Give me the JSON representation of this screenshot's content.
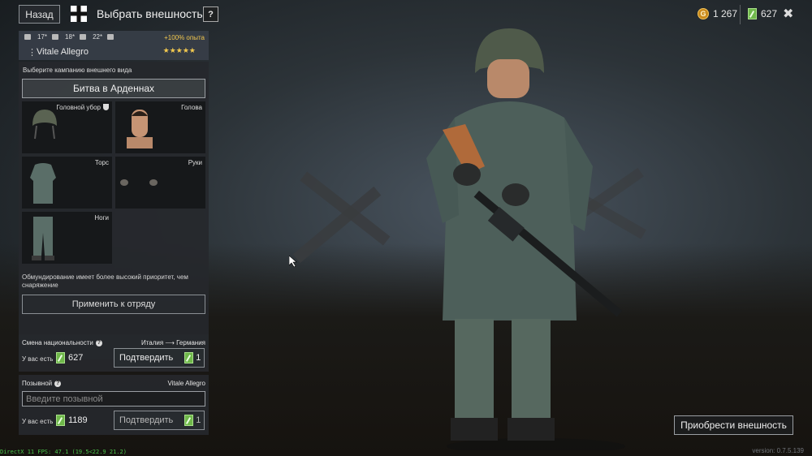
{
  "header": {
    "back_label": "Назад",
    "title": "Выбрать внешность",
    "help_label": "?",
    "gold": "1 267",
    "tickets": "627",
    "close_label": "✖"
  },
  "soldier": {
    "stat1": "17",
    "stat2": "18",
    "stat3": "22",
    "xp_bonus": "+100% опыта",
    "name": "Vitale Allegro",
    "stars": "★★★★★"
  },
  "appearance": {
    "campaign_label": "Выберите кампанию внешнего вида",
    "campaign": "Битва в Арденнах",
    "slots": {
      "head_gear": "Головной убор",
      "head": "Голова",
      "torso": "Торс",
      "hands": "Руки",
      "legs": "Ноги"
    },
    "priority_note": "Обмундирование имеет более высокий приоритет, чем снаряжение",
    "apply_label": "Применить к отряду"
  },
  "nationality": {
    "title": "Смена национальности",
    "from": "Италия",
    "arrow": "⟶",
    "to": "Германия",
    "have_label": "У вас есть",
    "have_value": "627",
    "confirm_label": "Подтвердить",
    "cost": "1"
  },
  "callsign": {
    "title": "Позывной",
    "current": "Vitale Allegro",
    "placeholder": "Введите позывной",
    "have_label": "У вас есть",
    "have_value": "1189",
    "confirm_label": "Подтвердить",
    "cost": "1"
  },
  "footer": {
    "buy_label": "Приобрести внешность",
    "fps": "DirectX 11 FPS: 47.1 (19.5<22.9 21.2)",
    "version": "version: 0.7.5.139"
  },
  "colors": {
    "accent_gold": "#f3c94f",
    "ticket_green": "#6fb84a",
    "fps_green": "#49c24a"
  },
  "icons": [
    "cross-icon",
    "help-icon",
    "gold-icon",
    "ticket-icon",
    "close-icon",
    "shield-icon",
    "question-icon"
  ]
}
